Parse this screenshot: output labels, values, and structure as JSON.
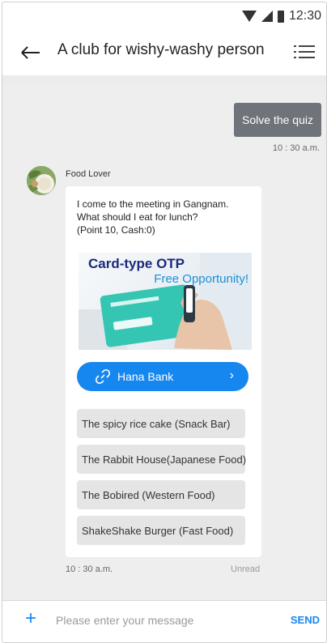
{
  "status_bar": {
    "time": "12:30"
  },
  "header": {
    "title": "A club for wishy-washy person"
  },
  "messages": {
    "outgoing": {
      "text": "Solve the quiz",
      "time": "10 : 30 a.m."
    },
    "incoming": {
      "sender": "Food Lover",
      "text_lines": [
        "I come to the meeting in Gangnam.",
        "What should I eat for lunch?",
        "(Point 10, Cash:0)"
      ],
      "banner": {
        "title": "Card-type OTP",
        "subtitle": "Free Opportunity!"
      },
      "link_button": "Hana Bank",
      "options": [
        "The spicy rice cake (Snack Bar)",
        "The Rabbit House(Japanese Food)",
        "The Bobired  (Western Food)",
        "ShakeShake Burger (Fast Food)"
      ],
      "time": "10 : 30 a.m.",
      "read_status": "Unread"
    }
  },
  "composer": {
    "placeholder": "Please enter your message",
    "send_label": "SEND"
  },
  "colors": {
    "accent": "#1787f0",
    "outgoing_bubble": "#6e747a",
    "chat_background": "#eeeeee"
  }
}
